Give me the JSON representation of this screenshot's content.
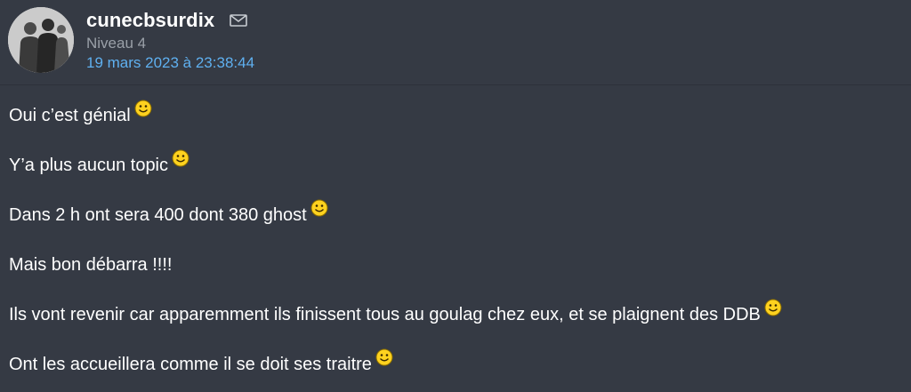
{
  "author": {
    "name": "cunecbsurdix",
    "level": "Niveau 4",
    "avatar_icon": "avatar-photo-silhouettes",
    "mail_icon": "envelope-icon"
  },
  "post": {
    "date": "19 mars 2023 à 23:38:44",
    "lines": [
      {
        "text": "Oui c’est génial",
        "emoji": "smiley"
      },
      {
        "text": "Y’a plus aucun topic",
        "emoji": "smiley"
      },
      {
        "text": "Dans 2 h ont sera 400 dont 380 ghost",
        "emoji": "smiley"
      },
      {
        "text": "Mais bon débarra !!!!",
        "emoji": ""
      },
      {
        "text": "Ils vont revenir car apparemment ils finissent tous au goulag chez eux, et se plaignent des DDB",
        "emoji": "smiley"
      },
      {
        "text": "Ont les accueillera comme il se doit ses traitre",
        "emoji": "smiley"
      }
    ]
  },
  "colors": {
    "background": "#353a44",
    "text": "#ffffff",
    "level": "#9aa0a8",
    "date": "#5fb0f0",
    "smiley": "#ffd21f"
  }
}
